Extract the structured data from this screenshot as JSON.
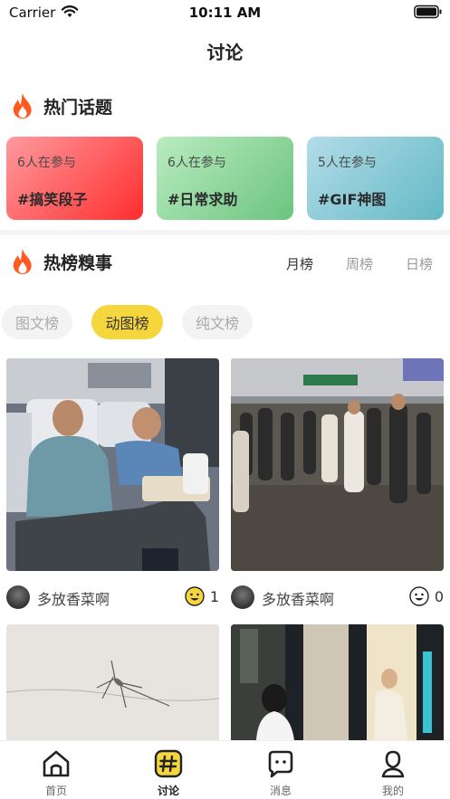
{
  "status_bar": {
    "carrier": "Carrier",
    "time": "10:11 AM"
  },
  "nav": {
    "title": "讨论"
  },
  "hot_topics": {
    "title": "热门话题",
    "items": [
      {
        "count": "6人在参与",
        "name": "#搞笑段子"
      },
      {
        "count": "6人在参与",
        "name": "#日常求助"
      },
      {
        "count": "5人在参与",
        "name": "#GIF神图"
      }
    ]
  },
  "ranking": {
    "title": "热榜糗事",
    "tabs": [
      "月榜",
      "周榜",
      "日榜"
    ],
    "active_tab": "月榜"
  },
  "filters": {
    "items": [
      "图文榜",
      "动图榜",
      "纯文榜"
    ],
    "active": "动图榜"
  },
  "posts": [
    {
      "author": "多放香菜啊",
      "likes": "1",
      "image": "train-passengers-sleeping-photo",
      "reaction": "smile-icon"
    },
    {
      "author": "多放香菜啊",
      "likes": "0",
      "image": "station-crowd-photo",
      "reaction": "smile-icon"
    },
    {
      "author": "",
      "likes": "",
      "image": "mosquito-on-wall-photo",
      "reaction": ""
    },
    {
      "author": "",
      "likes": "",
      "image": "woman-pillar-pose-photo",
      "reaction": ""
    }
  ],
  "tab_bar": {
    "items": [
      {
        "label": "首页",
        "icon": "home-icon"
      },
      {
        "label": "讨论",
        "icon": "hashtag-icon"
      },
      {
        "label": "消息",
        "icon": "message-icon"
      },
      {
        "label": "我的",
        "icon": "profile-icon"
      }
    ],
    "active": "讨论"
  },
  "colors": {
    "accent_yellow": "#f5d63d",
    "fire_orange": "#ff5a1f"
  }
}
